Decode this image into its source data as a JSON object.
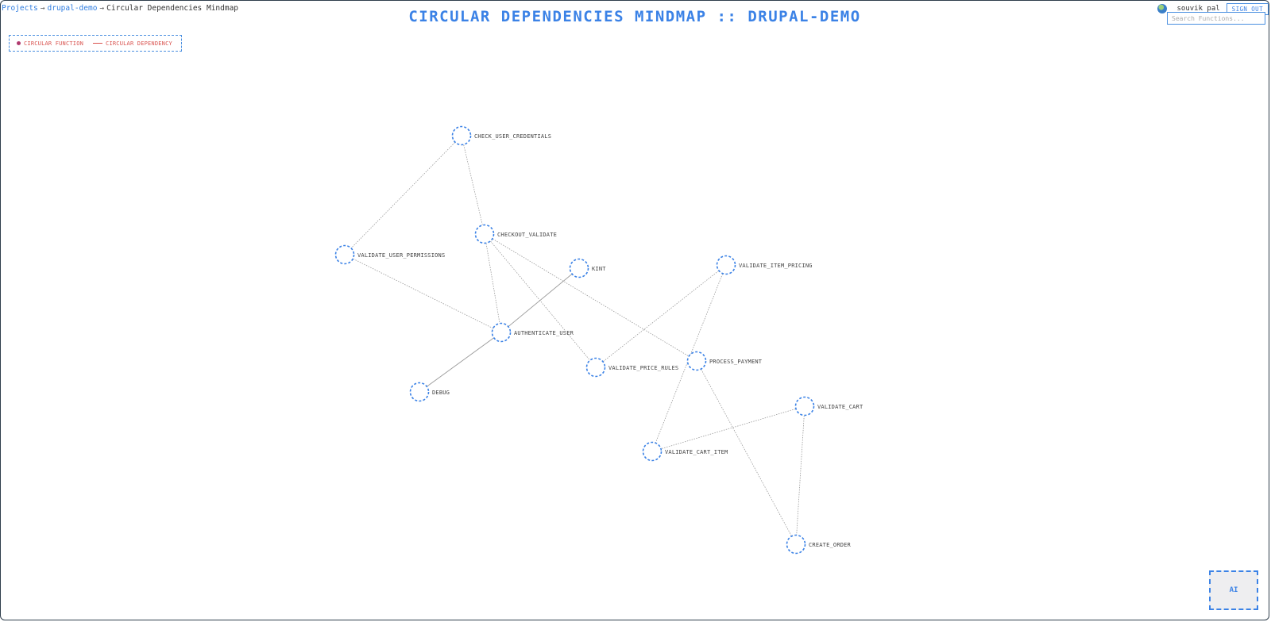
{
  "breadcrumb": {
    "projects": "Projects",
    "separator": "→",
    "project": "drupal-demo",
    "current": "Circular Dependencies Mindmap"
  },
  "title": "CIRCULAR DEPENDENCIES MINDMAP :: DRUPAL-DEMO",
  "legend": {
    "function_label": "CIRCULAR FUNCTION",
    "dependency_label": "CIRCULAR DEPENDENCY"
  },
  "user": {
    "name": "souvik pal",
    "signout_label": "SIGN OUT"
  },
  "search": {
    "placeholder": "Search Functions...",
    "value": ""
  },
  "ai_button": {
    "label": "AI"
  },
  "colors": {
    "accent": "#3b82e6",
    "legend_text": "#d9534f",
    "edge": "#9a9a9a"
  },
  "graph": {
    "nodes": [
      {
        "id": "check_user_credentials",
        "label": "CHECK_USER_CREDENTIALS"
      },
      {
        "id": "checkout_validate",
        "label": "CHECKOUT_VALIDATE"
      },
      {
        "id": "validate_user_permissions",
        "label": "VALIDATE_USER_PERMISSIONS"
      },
      {
        "id": "kint",
        "label": "KINT"
      },
      {
        "id": "validate_item_pricing",
        "label": "VALIDATE_ITEM_PRICING"
      },
      {
        "id": "authenticate_user",
        "label": "AUTHENTICATE_USER"
      },
      {
        "id": "process_payment",
        "label": "PROCESS_PAYMENT"
      },
      {
        "id": "validate_price_rules",
        "label": "VALIDATE_PRICE_RULES"
      },
      {
        "id": "debug",
        "label": "DEBUG"
      },
      {
        "id": "validate_cart",
        "label": "VALIDATE_CART"
      },
      {
        "id": "validate_cart_item",
        "label": "VALIDATE_CART_ITEM"
      },
      {
        "id": "create_order",
        "label": "CREATE_ORDER"
      }
    ],
    "edges": [
      {
        "source": "check_user_credentials",
        "target": "validate_user_permissions",
        "style": "dotted"
      },
      {
        "source": "check_user_credentials",
        "target": "checkout_validate",
        "style": "dotted"
      },
      {
        "source": "validate_user_permissions",
        "target": "authenticate_user",
        "style": "dotted"
      },
      {
        "source": "checkout_validate",
        "target": "authenticate_user",
        "style": "dotted"
      },
      {
        "source": "checkout_validate",
        "target": "validate_price_rules",
        "style": "dotted"
      },
      {
        "source": "checkout_validate",
        "target": "process_payment",
        "style": "dotted"
      },
      {
        "source": "kint",
        "target": "authenticate_user",
        "style": "solid"
      },
      {
        "source": "authenticate_user",
        "target": "debug",
        "style": "solid"
      },
      {
        "source": "validate_item_pricing",
        "target": "validate_price_rules",
        "style": "dotted"
      },
      {
        "source": "validate_item_pricing",
        "target": "validate_cart_item",
        "style": "dotted"
      },
      {
        "source": "process_payment",
        "target": "create_order",
        "style": "dotted"
      },
      {
        "source": "validate_cart",
        "target": "validate_cart_item",
        "style": "dotted"
      },
      {
        "source": "validate_cart",
        "target": "create_order",
        "style": "dotted"
      }
    ]
  }
}
